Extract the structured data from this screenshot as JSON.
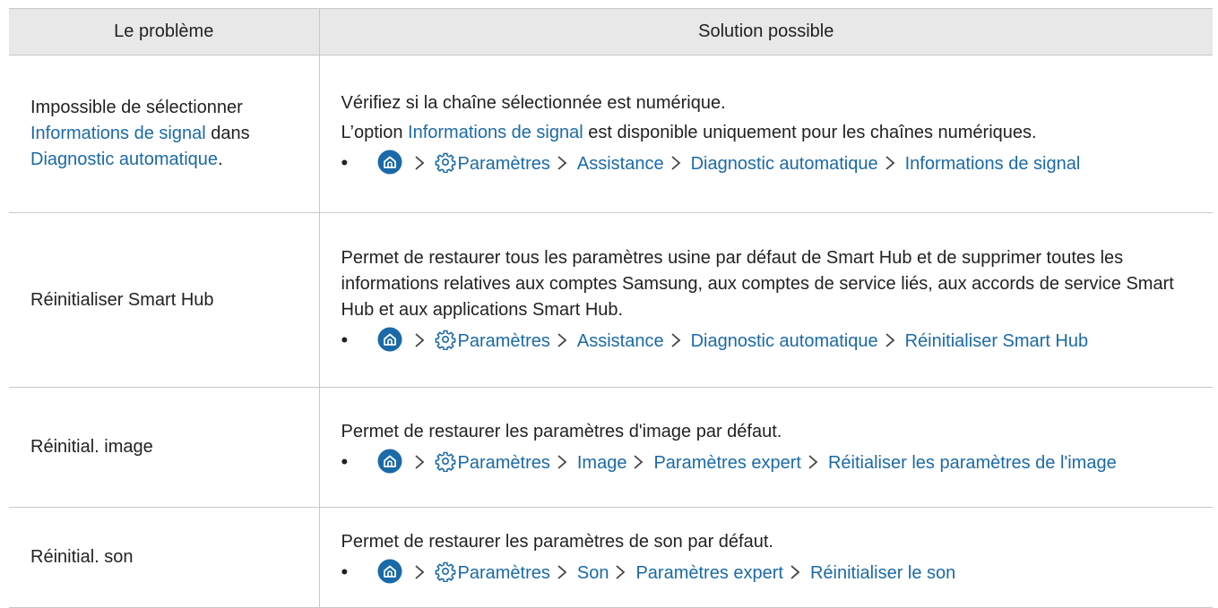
{
  "header": {
    "problem": "Le problème",
    "solution": "Solution possible"
  },
  "rows": [
    {
      "problem_pre": "Impossible de sélectionner",
      "problem_link1": "Informations de signal",
      "problem_mid": " dans",
      "problem_link2": "Diagnostic automatique",
      "problem_end": ".",
      "line1": "Vérifiez si la chaîne sélectionnée est numérique.",
      "line2_pre": "L’option ",
      "line2_link": "Informations de signal",
      "line2_post": " est disponible uniquement pour les chaînes numériques.",
      "path": [
        "Paramètres",
        "Assistance",
        "Diagnostic automatique",
        "Informations de signal"
      ]
    },
    {
      "problem": "Réinitialiser Smart Hub",
      "description": "Permet de restaurer tous les paramètres usine par défaut de Smart Hub et de supprimer toutes les informations relatives aux comptes Samsung, aux comptes de service liés, aux accords de service Smart Hub et aux applications Smart Hub.",
      "path": [
        "Paramètres",
        "Assistance",
        "Diagnostic automatique",
        "Réinitialiser Smart Hub"
      ]
    },
    {
      "problem": "Réinitial. image",
      "description": "Permet de restaurer les paramètres d'image par défaut.",
      "path": [
        "Paramètres",
        "Image",
        "Paramètres expert",
        "Réitialiser les paramètres de l'image"
      ]
    },
    {
      "problem": "Réinitial. son",
      "description": "Permet de restaurer les paramètres de son par défaut.",
      "path": [
        "Paramètres",
        "Son",
        "Paramètres expert",
        "Réinitialiser le son"
      ]
    }
  ],
  "colors": {
    "link": "#1a6aa8",
    "header_bg": "#e8e8e8",
    "border": "#c8c8c8"
  },
  "icons": [
    "home-icon",
    "gear-icon",
    "chevron-right-icon"
  ]
}
